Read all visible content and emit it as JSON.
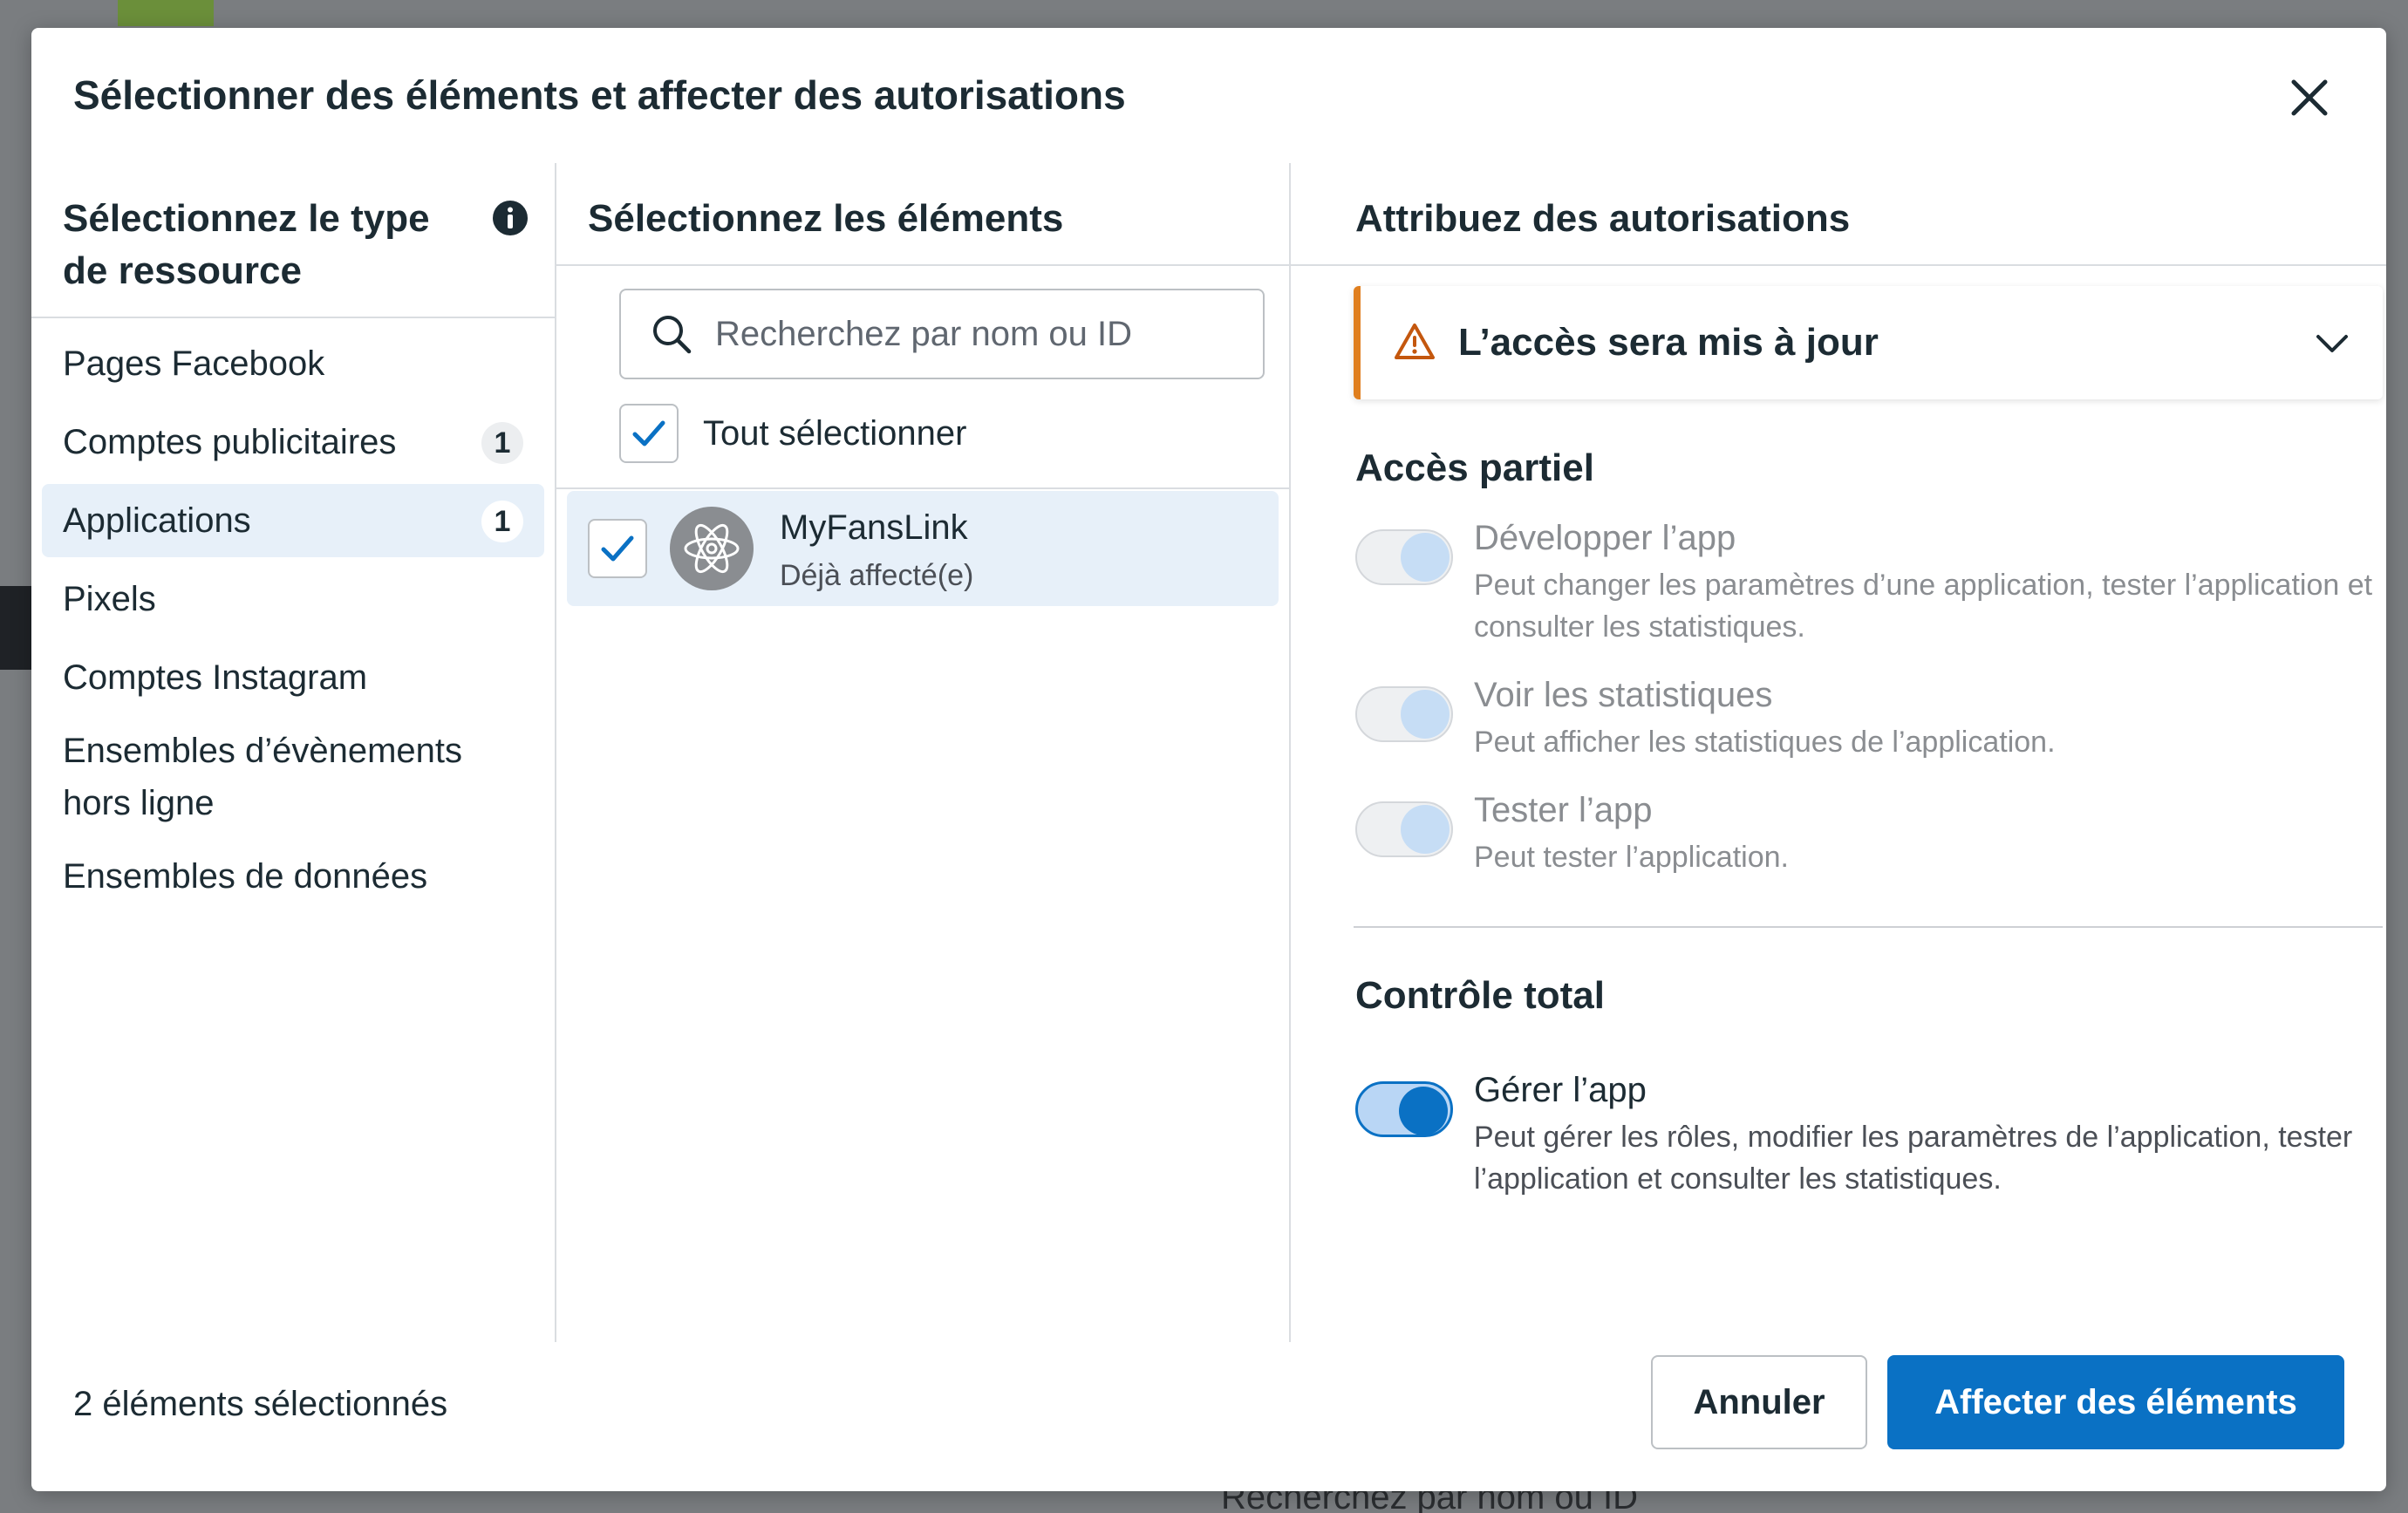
{
  "dialog": {
    "title": "Sélectionner des éléments et affecter des autorisations"
  },
  "left": {
    "header": "Sélectionnez le type de ressource",
    "items": [
      {
        "label": "Pages Facebook",
        "badge": ""
      },
      {
        "label": "Comptes publicitaires",
        "badge": "1"
      },
      {
        "label": "Applications",
        "badge": "1",
        "selected": true
      },
      {
        "label": "Pixels",
        "badge": ""
      },
      {
        "label": "Comptes Instagram",
        "badge": ""
      },
      {
        "label": "Ensembles d’évènements hors ligne",
        "badge": ""
      },
      {
        "label": "Ensembles de données",
        "badge": ""
      }
    ]
  },
  "middle": {
    "header": "Sélectionnez les éléments",
    "search_placeholder": "Recherchez par nom ou ID",
    "select_all_label": "Tout sélectionner",
    "select_all_checked": true,
    "assets": [
      {
        "name": "MyFansLink",
        "status": "Déjà affecté(e)",
        "checked": true
      }
    ]
  },
  "right": {
    "header": "Attribuez des autorisations",
    "warning": "L’accès sera mis à jour",
    "partial_title": "Accès partiel",
    "partial": [
      {
        "title": "Développer l’app",
        "desc": "Peut changer les paramètres d’une application, tester l’application et consulter les statistiques.",
        "state": "on-disabled"
      },
      {
        "title": "Voir les statistiques",
        "desc": "Peut afficher les statistiques de l’application.",
        "state": "on-disabled"
      },
      {
        "title": "Tester l’app",
        "desc": "Peut tester l’application.",
        "state": "on-disabled"
      }
    ],
    "full_title": "Contrôle total",
    "full": [
      {
        "title": "Gérer l’app",
        "desc": "Peut gérer les rôles, modifier les paramètres de l’application, tester l’application et consulter les statistiques.",
        "state": "on"
      }
    ]
  },
  "footer": {
    "selected_count": "2 éléments sélectionnés",
    "cancel_label": "Annuler",
    "assign_label": "Affecter des éléments"
  },
  "background": {
    "search_placeholder": "Recherchez par nom ou ID"
  },
  "colors": {
    "primary": "#0a71c4",
    "selected_bg": "#e7f0f9",
    "warning": "#e07f1f"
  }
}
